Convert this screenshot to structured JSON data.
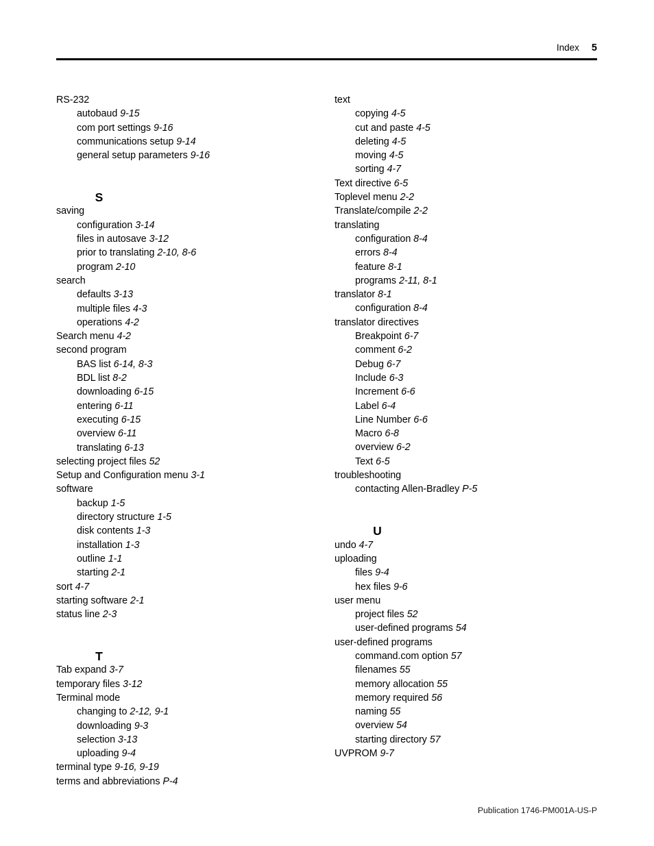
{
  "header": {
    "label": "Index",
    "folio": "5"
  },
  "footer": {
    "publication": "Publication 1746-PM001A-US-P"
  },
  "columns": {
    "left": [
      {
        "kind": "entry",
        "level": 1,
        "text": "RS-232",
        "page": ""
      },
      {
        "kind": "entry",
        "level": 2,
        "text": "autobaud",
        "page": "9-15"
      },
      {
        "kind": "entry",
        "level": 2,
        "text": "com port settings",
        "page": "9-16"
      },
      {
        "kind": "entry",
        "level": 2,
        "text": "communications setup",
        "page": "9-14"
      },
      {
        "kind": "entry",
        "level": 2,
        "text": "general setup parameters",
        "page": "9-16"
      },
      {
        "kind": "letter",
        "text": "S"
      },
      {
        "kind": "entry",
        "level": 1,
        "text": "saving",
        "page": ""
      },
      {
        "kind": "entry",
        "level": 2,
        "text": "configuration",
        "page": "3-14"
      },
      {
        "kind": "entry",
        "level": 2,
        "text": "files in autosave",
        "page": "3-12"
      },
      {
        "kind": "entry",
        "level": 2,
        "text": "prior to translating",
        "page": "2-10, 8-6"
      },
      {
        "kind": "entry",
        "level": 2,
        "text": "program",
        "page": "2-10"
      },
      {
        "kind": "entry",
        "level": 1,
        "text": "search",
        "page": ""
      },
      {
        "kind": "entry",
        "level": 2,
        "text": "defaults",
        "page": "3-13"
      },
      {
        "kind": "entry",
        "level": 2,
        "text": "multiple files",
        "page": "4-3"
      },
      {
        "kind": "entry",
        "level": 2,
        "text": "operations",
        "page": "4-2"
      },
      {
        "kind": "entry",
        "level": 1,
        "text": "Search menu",
        "page": "4-2"
      },
      {
        "kind": "entry",
        "level": 1,
        "text": "second program",
        "page": ""
      },
      {
        "kind": "entry",
        "level": 2,
        "text": "BAS list",
        "page": "6-14, 8-3"
      },
      {
        "kind": "entry",
        "level": 2,
        "text": "BDL list",
        "page": "8-2"
      },
      {
        "kind": "entry",
        "level": 2,
        "text": "downloading",
        "page": "6-15"
      },
      {
        "kind": "entry",
        "level": 2,
        "text": "entering",
        "page": "6-11"
      },
      {
        "kind": "entry",
        "level": 2,
        "text": "executing",
        "page": "6-15"
      },
      {
        "kind": "entry",
        "level": 2,
        "text": "overview",
        "page": "6-11"
      },
      {
        "kind": "entry",
        "level": 2,
        "text": "translating",
        "page": "6-13"
      },
      {
        "kind": "entry",
        "level": 1,
        "text": "selecting project files",
        "page": "52"
      },
      {
        "kind": "entry",
        "level": 1,
        "text": "Setup and Configuration menu",
        "page": "3-1"
      },
      {
        "kind": "entry",
        "level": 1,
        "text": "software",
        "page": ""
      },
      {
        "kind": "entry",
        "level": 2,
        "text": "backup",
        "page": "1-5"
      },
      {
        "kind": "entry",
        "level": 2,
        "text": "directory structure",
        "page": "1-5"
      },
      {
        "kind": "entry",
        "level": 2,
        "text": "disk contents",
        "page": "1-3"
      },
      {
        "kind": "entry",
        "level": 2,
        "text": "installation",
        "page": "1-3"
      },
      {
        "kind": "entry",
        "level": 2,
        "text": "outline",
        "page": "1-1"
      },
      {
        "kind": "entry",
        "level": 2,
        "text": "starting",
        "page": "2-1"
      },
      {
        "kind": "entry",
        "level": 1,
        "text": "sort",
        "page": "4-7"
      },
      {
        "kind": "entry",
        "level": 1,
        "text": "starting software",
        "page": "2-1"
      },
      {
        "kind": "entry",
        "level": 1,
        "text": "status line",
        "page": "2-3"
      },
      {
        "kind": "letter",
        "text": "T"
      },
      {
        "kind": "entry",
        "level": 1,
        "text": "Tab expand",
        "page": "3-7"
      },
      {
        "kind": "entry",
        "level": 1,
        "text": "temporary files",
        "page": "3-12"
      },
      {
        "kind": "entry",
        "level": 1,
        "text": "Terminal mode",
        "page": ""
      },
      {
        "kind": "entry",
        "level": 2,
        "text": "changing to",
        "page": "2-12, 9-1"
      },
      {
        "kind": "entry",
        "level": 2,
        "text": "downloading",
        "page": "9-3"
      },
      {
        "kind": "entry",
        "level": 2,
        "text": "selection",
        "page": "3-13"
      },
      {
        "kind": "entry",
        "level": 2,
        "text": "uploading",
        "page": "9-4"
      },
      {
        "kind": "entry",
        "level": 1,
        "text": "terminal type",
        "page": "9-16, 9-19"
      },
      {
        "kind": "entry",
        "level": 1,
        "text": "terms and abbreviations",
        "page": "P-4"
      }
    ],
    "right": [
      {
        "kind": "entry",
        "level": 1,
        "text": "text",
        "page": ""
      },
      {
        "kind": "entry",
        "level": 2,
        "text": "copying",
        "page": "4-5"
      },
      {
        "kind": "entry",
        "level": 2,
        "text": "cut and paste",
        "page": "4-5"
      },
      {
        "kind": "entry",
        "level": 2,
        "text": "deleting",
        "page": "4-5"
      },
      {
        "kind": "entry",
        "level": 2,
        "text": "moving",
        "page": "4-5"
      },
      {
        "kind": "entry",
        "level": 2,
        "text": "sorting",
        "page": "4-7"
      },
      {
        "kind": "entry",
        "level": 1,
        "text": "Text directive",
        "page": "6-5"
      },
      {
        "kind": "entry",
        "level": 1,
        "text": "Toplevel menu",
        "page": "2-2"
      },
      {
        "kind": "entry",
        "level": 1,
        "text": "Translate/compile",
        "page": "2-2"
      },
      {
        "kind": "entry",
        "level": 1,
        "text": "translating",
        "page": ""
      },
      {
        "kind": "entry",
        "level": 2,
        "text": "configuration",
        "page": "8-4"
      },
      {
        "kind": "entry",
        "level": 2,
        "text": "errors",
        "page": "8-4"
      },
      {
        "kind": "entry",
        "level": 2,
        "text": "feature",
        "page": "8-1"
      },
      {
        "kind": "entry",
        "level": 2,
        "text": "programs",
        "page": "2-11, 8-1"
      },
      {
        "kind": "entry",
        "level": 1,
        "text": "translator",
        "page": "8-1"
      },
      {
        "kind": "entry",
        "level": 2,
        "text": "configuration",
        "page": "8-4"
      },
      {
        "kind": "entry",
        "level": 1,
        "text": "translator directives",
        "page": ""
      },
      {
        "kind": "entry",
        "level": 2,
        "text": "Breakpoint",
        "page": "6-7"
      },
      {
        "kind": "entry",
        "level": 2,
        "text": "comment",
        "page": "6-2"
      },
      {
        "kind": "entry",
        "level": 2,
        "text": "Debug",
        "page": "6-7"
      },
      {
        "kind": "entry",
        "level": 2,
        "text": "Include",
        "page": "6-3"
      },
      {
        "kind": "entry",
        "level": 2,
        "text": "Increment",
        "page": "6-6"
      },
      {
        "kind": "entry",
        "level": 2,
        "text": "Label",
        "page": "6-4"
      },
      {
        "kind": "entry",
        "level": 2,
        "text": "Line Number",
        "page": "6-6"
      },
      {
        "kind": "entry",
        "level": 2,
        "text": "Macro",
        "page": "6-8"
      },
      {
        "kind": "entry",
        "level": 2,
        "text": "overview",
        "page": "6-2"
      },
      {
        "kind": "entry",
        "level": 2,
        "text": "Text",
        "page": "6-5"
      },
      {
        "kind": "entry",
        "level": 1,
        "text": "troubleshooting",
        "page": ""
      },
      {
        "kind": "entry",
        "level": 2,
        "text": "contacting Allen-Bradley",
        "page": "P-5"
      },
      {
        "kind": "letter",
        "text": "U"
      },
      {
        "kind": "entry",
        "level": 1,
        "text": "undo",
        "page": "4-7"
      },
      {
        "kind": "entry",
        "level": 1,
        "text": "uploading",
        "page": ""
      },
      {
        "kind": "entry",
        "level": 2,
        "text": "files",
        "page": "9-4"
      },
      {
        "kind": "entry",
        "level": 2,
        "text": "hex files",
        "page": "9-6"
      },
      {
        "kind": "entry",
        "level": 1,
        "text": "user menu",
        "page": ""
      },
      {
        "kind": "entry",
        "level": 2,
        "text": "project files",
        "page": "52"
      },
      {
        "kind": "entry",
        "level": 2,
        "text": "user-defined programs",
        "page": "54"
      },
      {
        "kind": "entry",
        "level": 1,
        "text": "user-defined programs",
        "page": ""
      },
      {
        "kind": "entry",
        "level": 2,
        "text": "command.com option",
        "page": "57"
      },
      {
        "kind": "entry",
        "level": 2,
        "text": "filenames",
        "page": "55"
      },
      {
        "kind": "entry",
        "level": 2,
        "text": "memory allocation",
        "page": "55"
      },
      {
        "kind": "entry",
        "level": 2,
        "text": "memory required",
        "page": "56"
      },
      {
        "kind": "entry",
        "level": 2,
        "text": "naming",
        "page": "55"
      },
      {
        "kind": "entry",
        "level": 2,
        "text": "overview",
        "page": "54"
      },
      {
        "kind": "entry",
        "level": 2,
        "text": "starting directory",
        "page": "57"
      },
      {
        "kind": "entry",
        "level": 1,
        "text": "UVPROM",
        "page": "9-7"
      }
    ]
  }
}
